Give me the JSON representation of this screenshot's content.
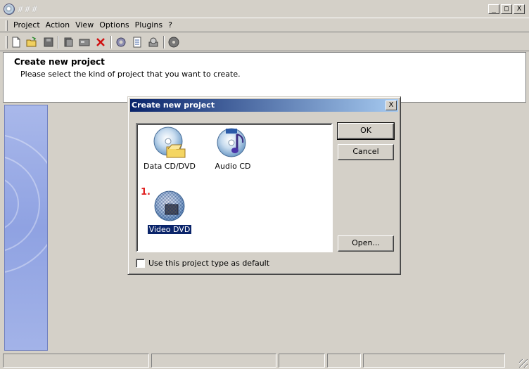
{
  "window": {
    "title": "###",
    "min": "_",
    "max": "□",
    "close": "X"
  },
  "menu": [
    "Project",
    "Action",
    "View",
    "Options",
    "Plugins",
    "?"
  ],
  "toolbar": {
    "icons": [
      "new-icon",
      "open-icon",
      "save-icon",
      "copy-icon",
      "burn-icon",
      "delete-icon",
      "settings-icon",
      "properties-icon",
      "device-icon",
      "disc-icon"
    ]
  },
  "header": {
    "title": "Create new project",
    "subtitle": "Please select the kind of project that you want to create."
  },
  "dialog": {
    "title": "Create new project",
    "close": "X",
    "items": [
      {
        "label": "Data CD/DVD",
        "icon": "data-cd-icon",
        "selected": false
      },
      {
        "label": "Audio CD",
        "icon": "audio-cd-icon",
        "selected": false
      },
      {
        "label": "Video DVD",
        "icon": "video-dvd-icon",
        "selected": true
      }
    ],
    "step_marker": "1.",
    "ok": "OK",
    "cancel": "Cancel",
    "open": "Open...",
    "default_checkbox": {
      "label": "Use this project type as default",
      "checked": false
    }
  }
}
